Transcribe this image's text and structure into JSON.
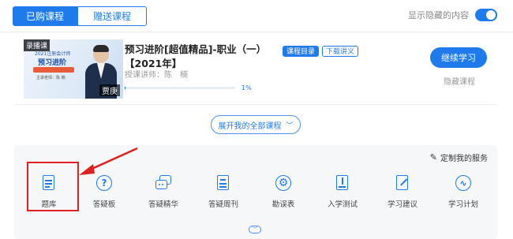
{
  "tabs": [
    {
      "label": "已购课程",
      "active": true
    },
    {
      "label": "赠送课程",
      "active": false
    }
  ],
  "toggle": {
    "label": "显示隐藏的内容",
    "on": true
  },
  "course": {
    "thumb": {
      "tag": "录播课",
      "line1": "2021注册会计师",
      "line2": "预习进阶",
      "line3": "精品课程全新推出了！",
      "line4": "主讲老师：陈 楠",
      "name": "贾庚"
    },
    "title": "预习进阶[超值精品]-职业（一）【2021年】",
    "badges": [
      "课程目录",
      "下载讲义"
    ],
    "teacher": "授课讲师：陈　楠",
    "progress": 0.01,
    "progress_text": "1%",
    "continue": "继续学习",
    "hide": "隐藏课程"
  },
  "expand": {
    "label": "展开我的全部课程",
    "chevron": "﹀"
  },
  "services": {
    "customize": "定制我的服务",
    "items": [
      {
        "label": "题库",
        "icon": "question-bank-icon"
      },
      {
        "label": "答疑板",
        "icon": "qa-board-icon"
      },
      {
        "label": "答疑精华",
        "icon": "qa-highlights-icon"
      },
      {
        "label": "答疑周刊",
        "icon": "qa-weekly-icon"
      },
      {
        "label": "勘误表",
        "icon": "errata-icon"
      },
      {
        "label": "入学测试",
        "icon": "entrance-test-icon"
      },
      {
        "label": "学习建议",
        "icon": "study-advice-icon"
      },
      {
        "label": "学习计划",
        "icon": "study-plan-icon"
      }
    ]
  },
  "annotation": {
    "color": "#e02020"
  },
  "colors": {
    "accent": "#1f7bec",
    "panel": "#f6f7f9"
  }
}
